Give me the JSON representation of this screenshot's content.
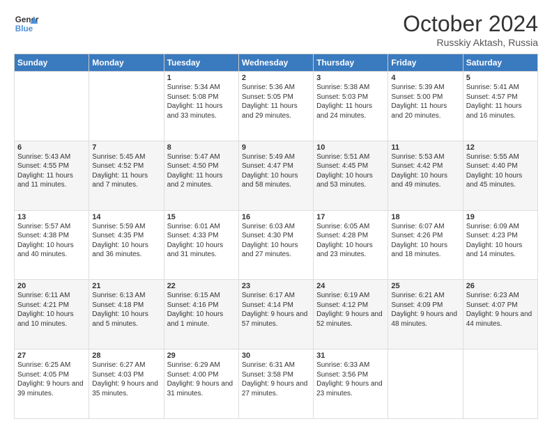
{
  "header": {
    "logo_general": "General",
    "logo_blue": "Blue",
    "month": "October 2024",
    "location": "Russkiy Aktash, Russia"
  },
  "weekdays": [
    "Sunday",
    "Monday",
    "Tuesday",
    "Wednesday",
    "Thursday",
    "Friday",
    "Saturday"
  ],
  "weeks": [
    [
      {
        "day": "",
        "info": ""
      },
      {
        "day": "",
        "info": ""
      },
      {
        "day": "1",
        "info": "Sunrise: 5:34 AM\nSunset: 5:08 PM\nDaylight: 11 hours and 33 minutes."
      },
      {
        "day": "2",
        "info": "Sunrise: 5:36 AM\nSunset: 5:05 PM\nDaylight: 11 hours and 29 minutes."
      },
      {
        "day": "3",
        "info": "Sunrise: 5:38 AM\nSunset: 5:03 PM\nDaylight: 11 hours and 24 minutes."
      },
      {
        "day": "4",
        "info": "Sunrise: 5:39 AM\nSunset: 5:00 PM\nDaylight: 11 hours and 20 minutes."
      },
      {
        "day": "5",
        "info": "Sunrise: 5:41 AM\nSunset: 4:57 PM\nDaylight: 11 hours and 16 minutes."
      }
    ],
    [
      {
        "day": "6",
        "info": "Sunrise: 5:43 AM\nSunset: 4:55 PM\nDaylight: 11 hours and 11 minutes."
      },
      {
        "day": "7",
        "info": "Sunrise: 5:45 AM\nSunset: 4:52 PM\nDaylight: 11 hours and 7 minutes."
      },
      {
        "day": "8",
        "info": "Sunrise: 5:47 AM\nSunset: 4:50 PM\nDaylight: 11 hours and 2 minutes."
      },
      {
        "day": "9",
        "info": "Sunrise: 5:49 AM\nSunset: 4:47 PM\nDaylight: 10 hours and 58 minutes."
      },
      {
        "day": "10",
        "info": "Sunrise: 5:51 AM\nSunset: 4:45 PM\nDaylight: 10 hours and 53 minutes."
      },
      {
        "day": "11",
        "info": "Sunrise: 5:53 AM\nSunset: 4:42 PM\nDaylight: 10 hours and 49 minutes."
      },
      {
        "day": "12",
        "info": "Sunrise: 5:55 AM\nSunset: 4:40 PM\nDaylight: 10 hours and 45 minutes."
      }
    ],
    [
      {
        "day": "13",
        "info": "Sunrise: 5:57 AM\nSunset: 4:38 PM\nDaylight: 10 hours and 40 minutes."
      },
      {
        "day": "14",
        "info": "Sunrise: 5:59 AM\nSunset: 4:35 PM\nDaylight: 10 hours and 36 minutes."
      },
      {
        "day": "15",
        "info": "Sunrise: 6:01 AM\nSunset: 4:33 PM\nDaylight: 10 hours and 31 minutes."
      },
      {
        "day": "16",
        "info": "Sunrise: 6:03 AM\nSunset: 4:30 PM\nDaylight: 10 hours and 27 minutes."
      },
      {
        "day": "17",
        "info": "Sunrise: 6:05 AM\nSunset: 4:28 PM\nDaylight: 10 hours and 23 minutes."
      },
      {
        "day": "18",
        "info": "Sunrise: 6:07 AM\nSunset: 4:26 PM\nDaylight: 10 hours and 18 minutes."
      },
      {
        "day": "19",
        "info": "Sunrise: 6:09 AM\nSunset: 4:23 PM\nDaylight: 10 hours and 14 minutes."
      }
    ],
    [
      {
        "day": "20",
        "info": "Sunrise: 6:11 AM\nSunset: 4:21 PM\nDaylight: 10 hours and 10 minutes."
      },
      {
        "day": "21",
        "info": "Sunrise: 6:13 AM\nSunset: 4:18 PM\nDaylight: 10 hours and 5 minutes."
      },
      {
        "day": "22",
        "info": "Sunrise: 6:15 AM\nSunset: 4:16 PM\nDaylight: 10 hours and 1 minute."
      },
      {
        "day": "23",
        "info": "Sunrise: 6:17 AM\nSunset: 4:14 PM\nDaylight: 9 hours and 57 minutes."
      },
      {
        "day": "24",
        "info": "Sunrise: 6:19 AM\nSunset: 4:12 PM\nDaylight: 9 hours and 52 minutes."
      },
      {
        "day": "25",
        "info": "Sunrise: 6:21 AM\nSunset: 4:09 PM\nDaylight: 9 hours and 48 minutes."
      },
      {
        "day": "26",
        "info": "Sunrise: 6:23 AM\nSunset: 4:07 PM\nDaylight: 9 hours and 44 minutes."
      }
    ],
    [
      {
        "day": "27",
        "info": "Sunrise: 6:25 AM\nSunset: 4:05 PM\nDaylight: 9 hours and 39 minutes."
      },
      {
        "day": "28",
        "info": "Sunrise: 6:27 AM\nSunset: 4:03 PM\nDaylight: 9 hours and 35 minutes."
      },
      {
        "day": "29",
        "info": "Sunrise: 6:29 AM\nSunset: 4:00 PM\nDaylight: 9 hours and 31 minutes."
      },
      {
        "day": "30",
        "info": "Sunrise: 6:31 AM\nSunset: 3:58 PM\nDaylight: 9 hours and 27 minutes."
      },
      {
        "day": "31",
        "info": "Sunrise: 6:33 AM\nSunset: 3:56 PM\nDaylight: 9 hours and 23 minutes."
      },
      {
        "day": "",
        "info": ""
      },
      {
        "day": "",
        "info": ""
      }
    ]
  ]
}
